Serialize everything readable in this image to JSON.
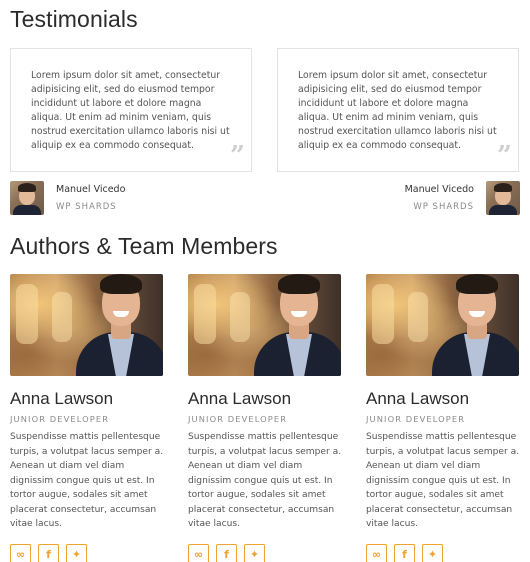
{
  "testimonials": {
    "title": "Testimonials",
    "items": [
      {
        "quote": "Lorem ipsum dolor sit amet, consectetur adipisicing elit, sed do eiusmod tempor incididunt ut labore et dolore magna aliqua. Ut enim ad minim veniam, quis nostrud exercitation ullamco laboris nisi ut aliquip ex ea commodo consequat.",
        "name": "Manuel Vicedo",
        "company": "WP SHARDS"
      },
      {
        "quote": "Lorem ipsum dolor sit amet, consectetur adipisicing elit, sed do eiusmod tempor incididunt ut labore et dolore magna aliqua. Ut enim ad minim veniam, quis nostrud exercitation ullamco laboris nisi ut aliquip ex ea commodo consequat.",
        "name": "Manuel Vicedo",
        "company": "WP SHARDS"
      }
    ],
    "quote_icon": "quote-icon"
  },
  "team": {
    "title": "Authors & Team Members",
    "members": [
      {
        "name": "Anna Lawson",
        "role": "JUNIOR DEVELOPER",
        "bio": "Suspendisse mattis pellentesque turpis, a volutpat lacus semper a. Aenean ut diam vel diam dignissim congue quis ut est. In tortor augue, sodales sit amet placerat consectetur, accumsan vitae lacus."
      },
      {
        "name": "Anna Lawson",
        "role": "JUNIOR DEVELOPER",
        "bio": "Suspendisse mattis pellentesque turpis, a volutpat lacus semper a. Aenean ut diam vel diam dignissim congue quis ut est. In tortor augue, sodales sit amet placerat consectetur, accumsan vitae lacus."
      },
      {
        "name": "Anna Lawson",
        "role": "JUNIOR DEVELOPER",
        "bio": "Suspendisse mattis pellentesque turpis, a volutpat lacus semper a. Aenean ut diam vel diam dignissim congue quis ut est. In tortor augue, sodales sit amet placerat consectetur, accumsan vitae lacus."
      }
    ],
    "social_icons": [
      "link-icon",
      "facebook-icon",
      "twitter-icon"
    ]
  },
  "colors": {
    "accent": "#f0a232",
    "heading": "#2b2b2b",
    "muted": "#8a8a8a"
  }
}
